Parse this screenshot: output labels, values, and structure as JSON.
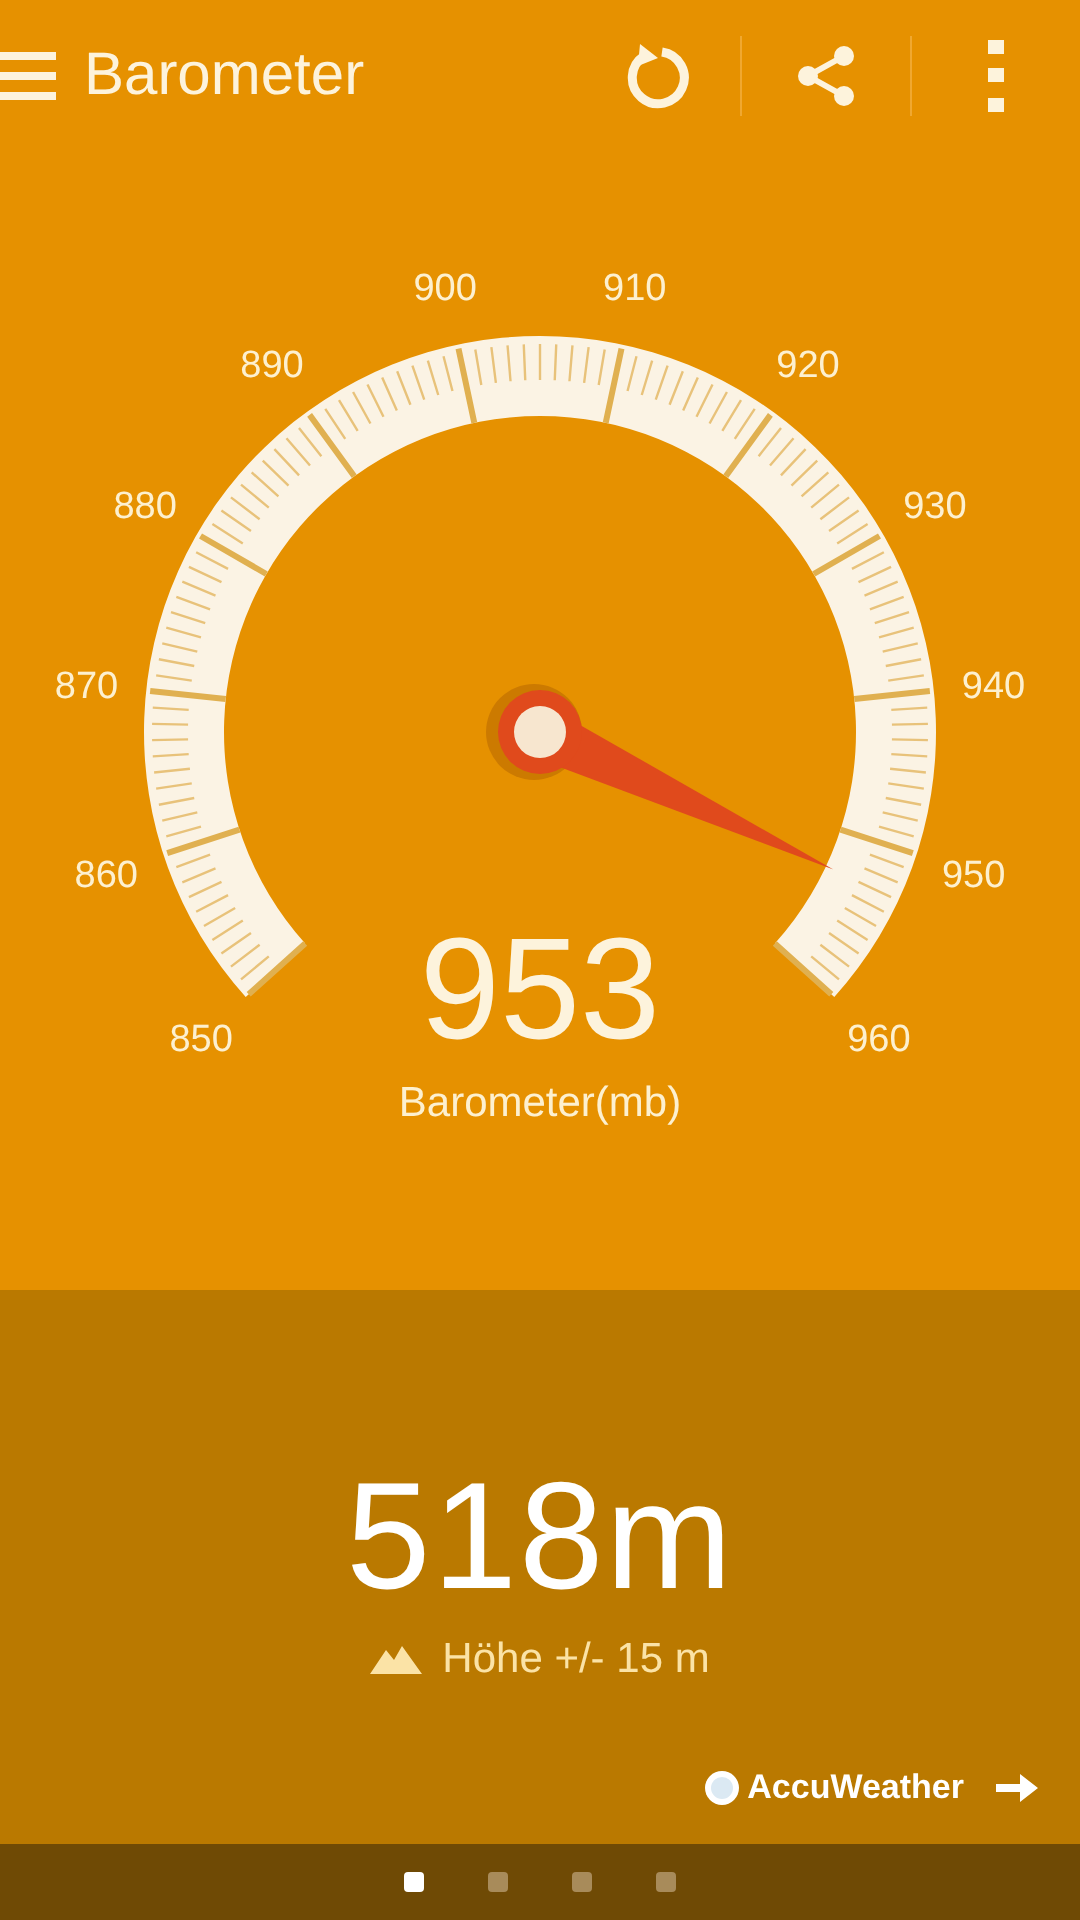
{
  "app_bar": {
    "title": "Barometer"
  },
  "gauge": {
    "scale_labels": [
      "850",
      "860",
      "870",
      "880",
      "890",
      "900",
      "910",
      "920",
      "930",
      "940",
      "950",
      "960"
    ],
    "reading": "953",
    "unit_label": "Barometer(mb)"
  },
  "altitude": {
    "value": "518m",
    "accuracy": "Höhe +/- 15 m"
  },
  "provider": {
    "name": "AccuWeather"
  },
  "pages": [
    {
      "selected": true
    },
    {
      "selected": false
    },
    {
      "selected": false
    },
    {
      "selected": false
    }
  ]
}
